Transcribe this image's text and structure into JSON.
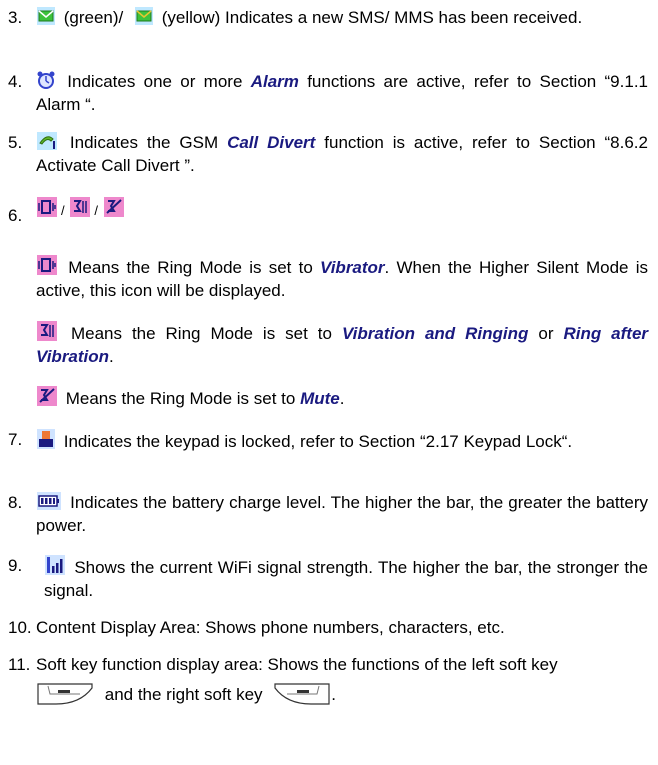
{
  "items": [
    {
      "num": "3.",
      "green_word": "(green)/",
      "yellow_word": "(yellow) Indicates a new SMS/ MMS has been received."
    },
    {
      "num": "4.",
      "pre": "Indicates one or more",
      "bold": "Alarm",
      "post": "functions are active, refer to Section “9.1.1 Alarm “."
    },
    {
      "num": "5.",
      "pre": "Indicates the GSM",
      "bold": "Call Divert",
      "post": "function is active, refer to Section “8.6.2 Activate Call Divert ”."
    },
    {
      "num": "6.",
      "sep1": "/",
      "sep2": "/",
      "vib": {
        "pre": "Means the Ring Mode is set to",
        "bold": "Vibrator",
        "post": ". When the Higher Silent Mode is active, this icon will be displayed."
      },
      "vibring": {
        "pre": "Means the Ring Mode is set to",
        "bold1": "Vibration and Ringing",
        "mid": "or",
        "bold2": "Ring after Vibration",
        "post": "."
      },
      "mute": {
        "pre": "Means the Ring Mode is set to",
        "bold": "Mute",
        "post": "."
      }
    },
    {
      "num": "7.",
      "text": "Indicates the keypad is locked, refer to Section “2.17 Keypad Lock“."
    },
    {
      "num": "8.",
      "text": "Indicates the battery charge level. The higher the bar, the greater the battery power."
    },
    {
      "num": "9.",
      "text": "Shows the current WiFi signal strength. The higher the bar, the stronger the signal."
    },
    {
      "num": "10.",
      "text": "Content Display Area: Shows phone numbers, characters, etc."
    },
    {
      "num": "11.",
      "line1": "Soft key function display area: Shows the functions of the left soft key",
      "line2a": "and the right soft key",
      "line2b": "."
    }
  ],
  "icons": {
    "sms_green": "envelope-green-icon",
    "sms_yellow": "envelope-yellow-icon",
    "alarm": "alarm-icon",
    "call_divert": "call-divert-icon",
    "vibrator": "vibrator-icon",
    "vibration_ringing": "vibration-ringing-icon",
    "mute": "mute-icon",
    "keypad_lock": "keypad-lock-icon",
    "battery": "battery-icon",
    "wifi_signal": "wifi-signal-icon",
    "left_soft_key": "left-soft-key-icon",
    "right_soft_key": "right-soft-key-icon"
  },
  "colors": {
    "emphasis": "#1a1a80",
    "green_envelope": "#3cc23c",
    "yellow_envelope": "#e8c530",
    "icon_blue": "#3344cc",
    "icon_pink": "#ee88cc"
  }
}
